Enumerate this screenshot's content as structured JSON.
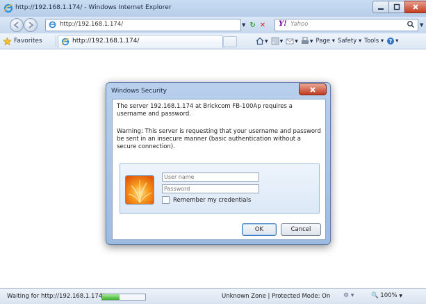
{
  "window": {
    "title": "http://192.168.1.174/ - Windows Internet Explorer"
  },
  "navigation": {
    "address": "http://192.168.1.174/",
    "search_placeholder": "Yahoo",
    "search_provider_logo": "Y!"
  },
  "favorites_bar": {
    "favorites_label": "Favorites",
    "tab_title": "http://192.168.1.174/",
    "commands": {
      "page": "Page ▾",
      "safety": "Safety ▾",
      "tools": "Tools ▾",
      "help": "▾"
    }
  },
  "dialog": {
    "title": "Windows Security",
    "message": "The server 192.168.1.174 at Brickcom FB-100Ap requires a username and password.",
    "warning": "Warning: This server is requesting that your username and password be sent in an insecure manner (basic authentication without a secure connection).",
    "username_placeholder": "User name",
    "password_placeholder": "Password",
    "remember_label": "Remember my credentials",
    "ok_label": "OK",
    "cancel_label": "Cancel"
  },
  "status_bar": {
    "status": "Waiting for http://192.168.1.174/.",
    "progress": 0.4,
    "zone": "Unknown Zone | Protected Mode: On",
    "zoom": "100%"
  }
}
